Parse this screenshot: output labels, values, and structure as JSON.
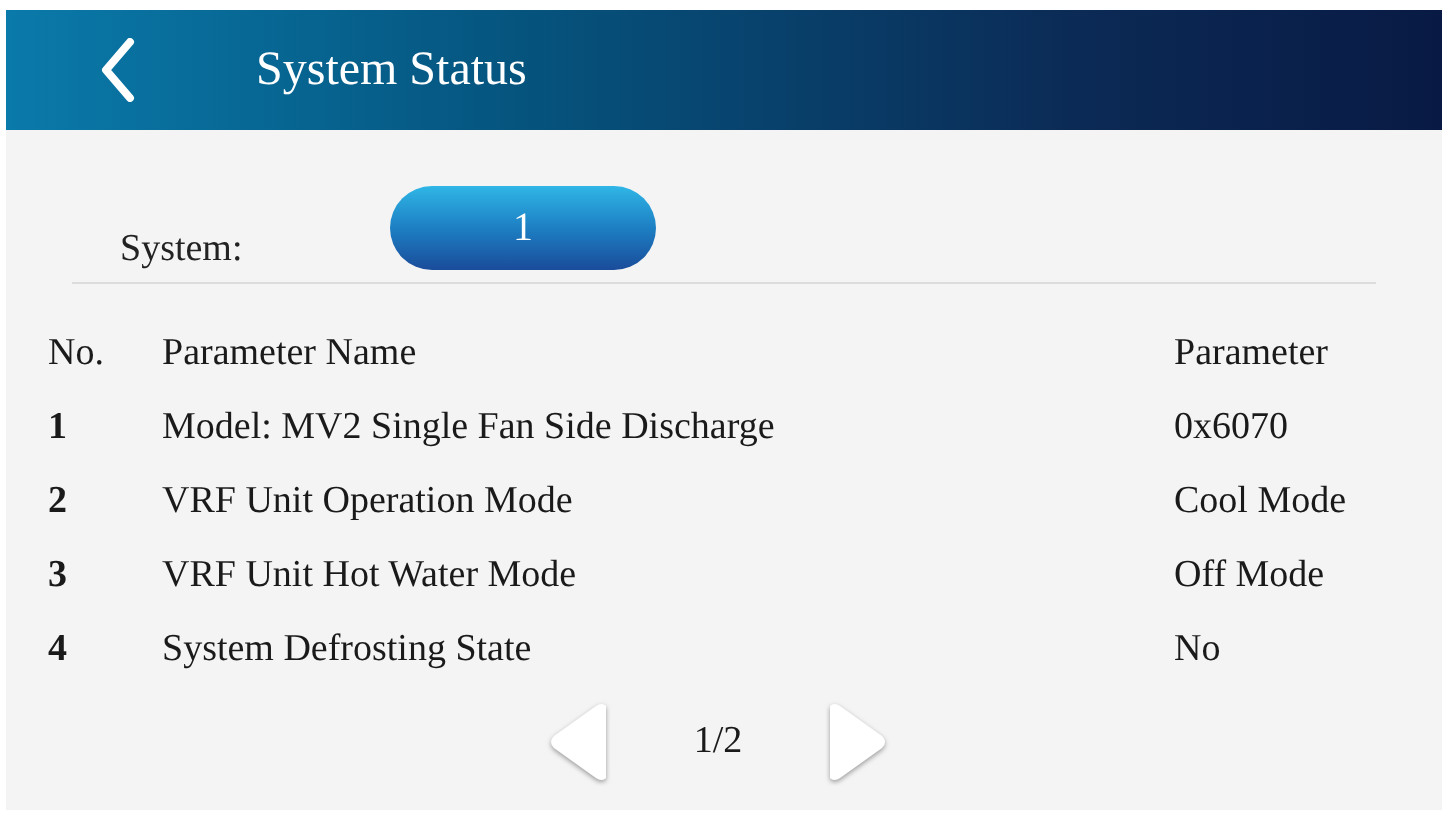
{
  "header": {
    "title": "System Status"
  },
  "system": {
    "label": "System:",
    "value": "1"
  },
  "table": {
    "columns": [
      "No.",
      "Parameter Name",
      "Parameter"
    ],
    "rows": [
      [
        "1",
        "Model: MV2 Single Fan Side Discharge",
        "0x6070"
      ],
      [
        "2",
        "VRF Unit Operation Mode",
        "Cool Mode"
      ],
      [
        "3",
        "VRF Unit Hot Water Mode",
        "Off Mode"
      ],
      [
        "4",
        "System Defrosting State",
        "No"
      ]
    ]
  },
  "pager": {
    "page": "1/2"
  }
}
